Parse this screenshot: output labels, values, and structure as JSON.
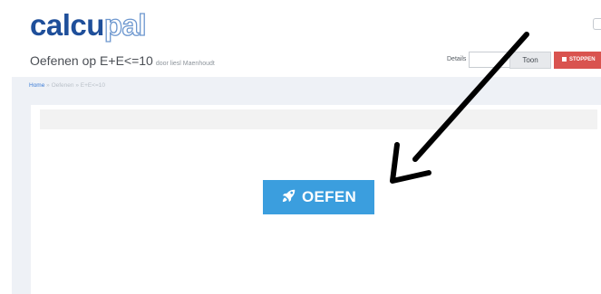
{
  "logo": {
    "part_dark": "calcu",
    "part_light": "pal"
  },
  "header": {
    "title": "Oefenen op E+E<=10",
    "byline": "door liesl Maenhoudt",
    "details_label": "Details",
    "details_value": "",
    "toon_label": "Toon",
    "stop_label": "STOPPEN"
  },
  "breadcrumb": {
    "home": "Home",
    "sep1": " » ",
    "oefenen": "Oefenen",
    "sep2": " » ",
    "current": "E+E<=10"
  },
  "main": {
    "start_button_label": "OEFEN",
    "start_button_icon": "rocket-icon"
  },
  "colors": {
    "brand_dark": "#1f4f9a",
    "brand_light": "#6d97cf",
    "primary_button": "#3b9ede",
    "stop_button": "#d9534f",
    "annotation_arrow": "#000000"
  }
}
